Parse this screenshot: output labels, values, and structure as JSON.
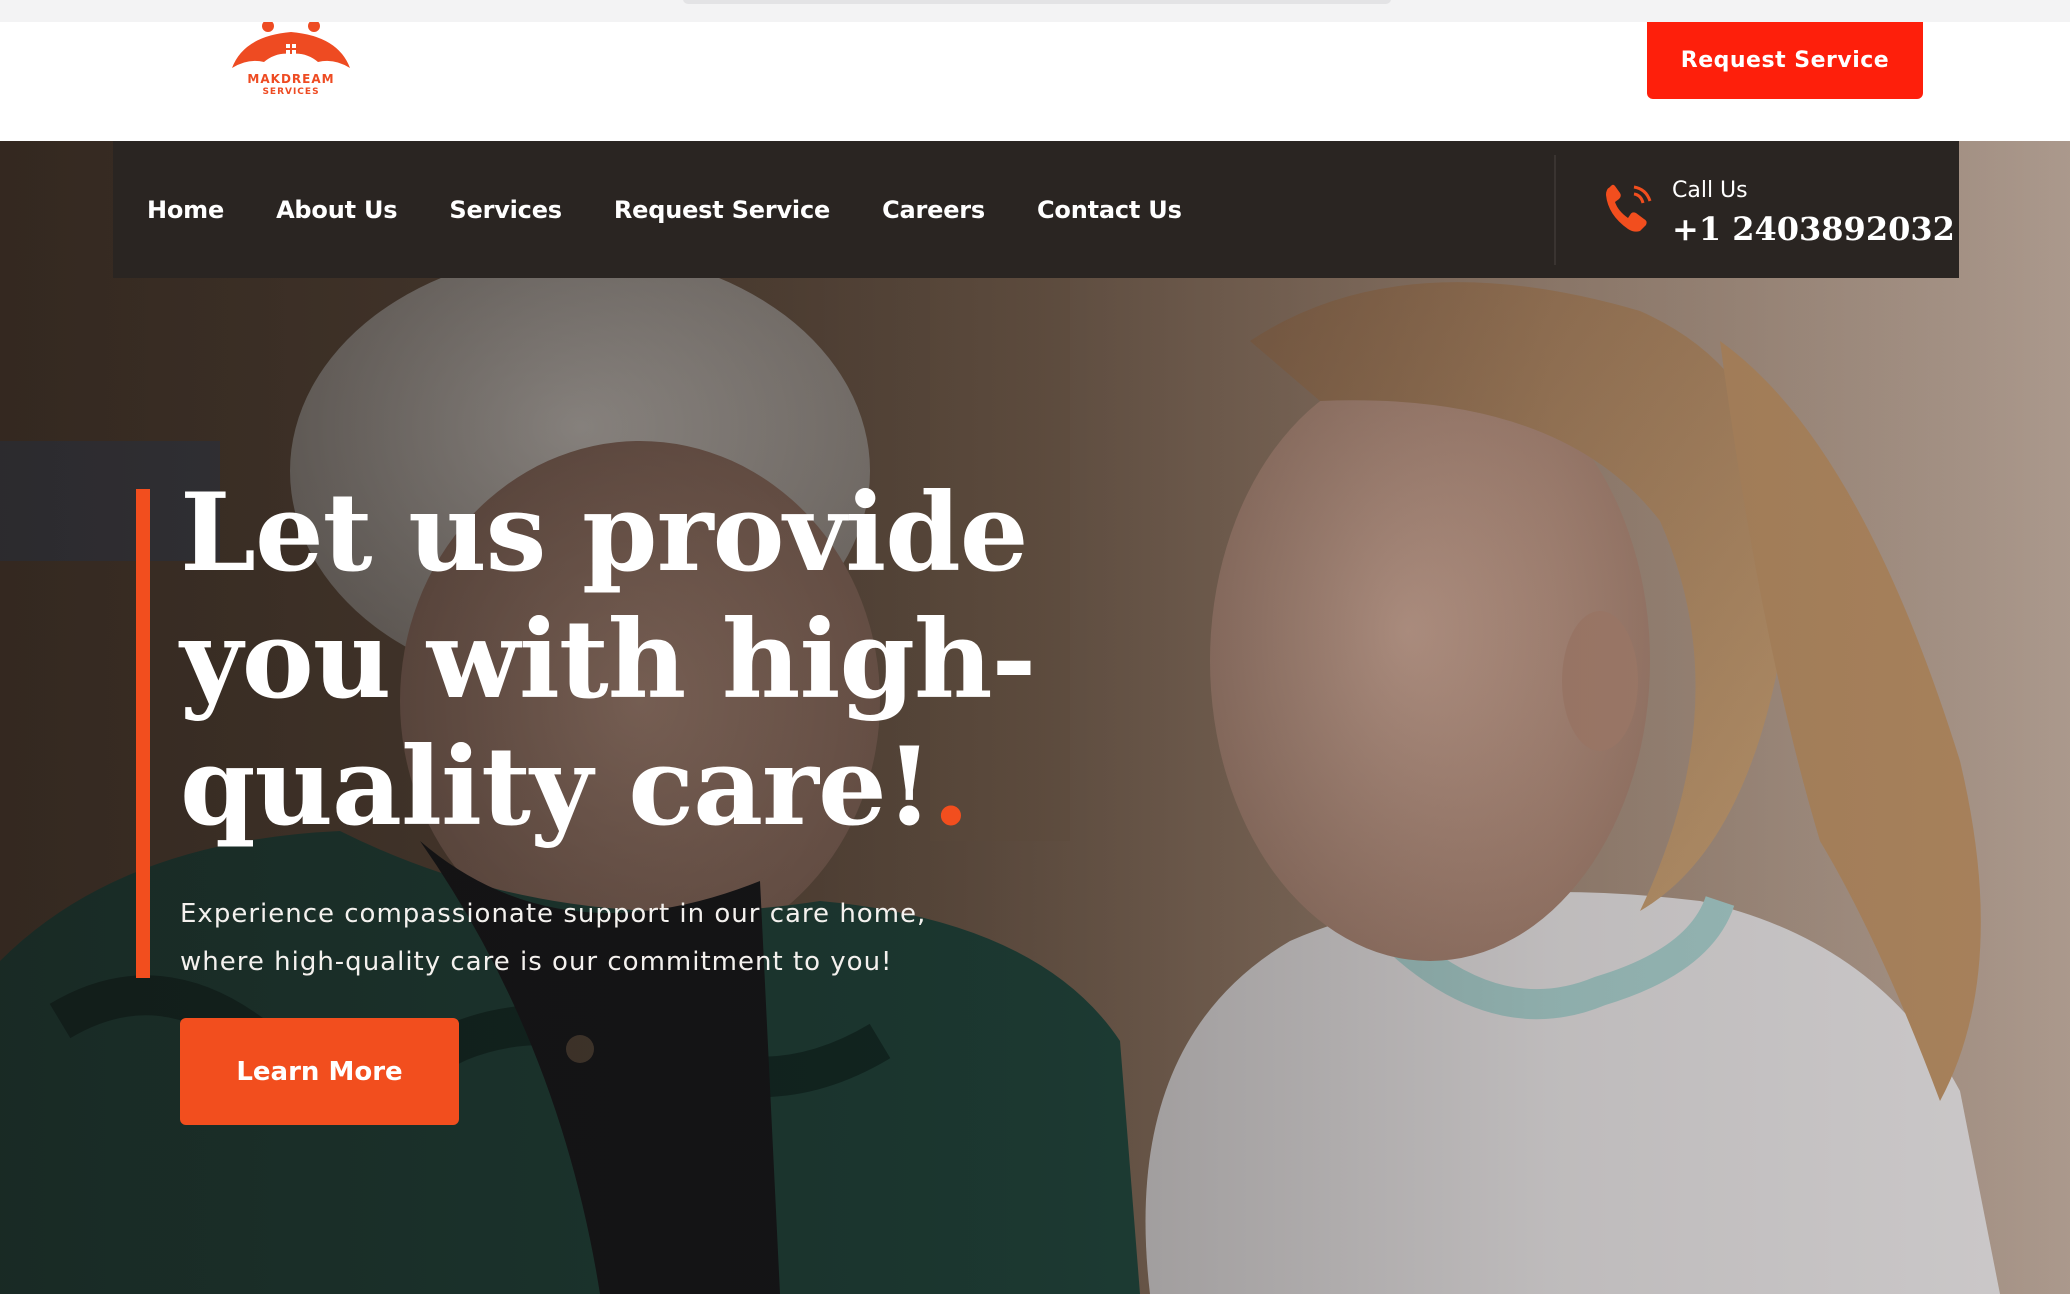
{
  "brand": {
    "name_line1": "MAKDREAM",
    "name_line2": "SERVICES",
    "accent_color": "#f24e1e",
    "cta_color": "#fe1f0b"
  },
  "header": {
    "cta_label": "Request Service"
  },
  "nav": {
    "items": [
      {
        "label": "Home"
      },
      {
        "label": "About Us"
      },
      {
        "label": "Services"
      },
      {
        "label": "Request Service"
      },
      {
        "label": "Careers"
      },
      {
        "label": "Contact Us"
      }
    ],
    "call": {
      "icon": "phone-icon",
      "label": "Call Us",
      "number": "+1 2403892032"
    }
  },
  "hero": {
    "title": "Let us provide you with high-quality care!",
    "title_dot": ".",
    "subtitle_line1": "Experience compassionate support in our care home,",
    "subtitle_line2": "where high-quality care is our commitment to you!",
    "cta_label": "Learn More",
    "image": "elderly woman and caregiver smiling"
  }
}
